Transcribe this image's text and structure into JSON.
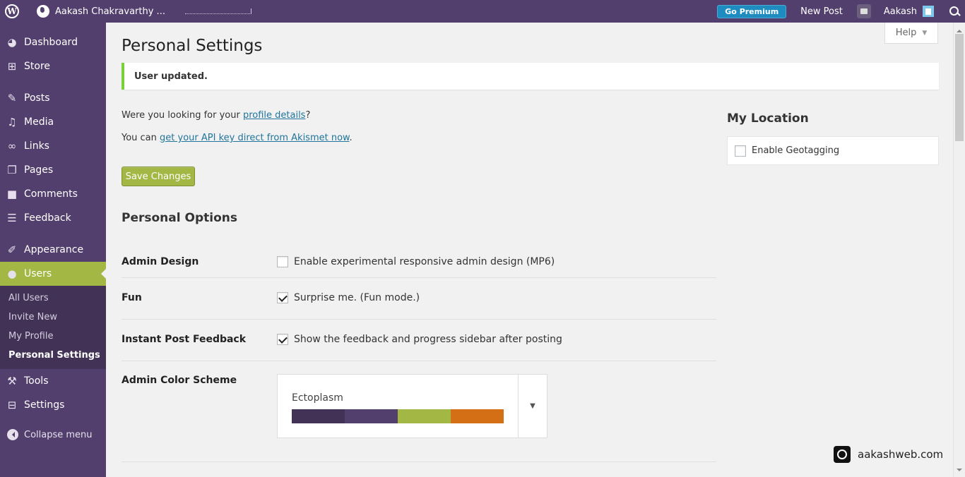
{
  "adminbar": {
    "site_name": "Aakash Chakravarthy ...",
    "go_premium": "Go Premium",
    "new_post": "New Post",
    "user": "Aakash"
  },
  "sidebar": {
    "items": [
      {
        "label": "Dashboard",
        "icon": "dashboard-icon"
      },
      {
        "label": "Store",
        "icon": "cart-icon"
      },
      {
        "label": "Posts",
        "icon": "pin-icon"
      },
      {
        "label": "Media",
        "icon": "media-icon"
      },
      {
        "label": "Links",
        "icon": "link-icon"
      },
      {
        "label": "Pages",
        "icon": "pages-icon"
      },
      {
        "label": "Comments",
        "icon": "comment-icon"
      },
      {
        "label": "Feedback",
        "icon": "feedback-icon"
      },
      {
        "label": "Appearance",
        "icon": "brush-icon"
      },
      {
        "label": "Users",
        "icon": "user-icon"
      },
      {
        "label": "Tools",
        "icon": "wrench-icon"
      },
      {
        "label": "Settings",
        "icon": "settings-icon"
      }
    ],
    "submenu": [
      "All Users",
      "Invite New",
      "My Profile",
      "Personal Settings"
    ],
    "collapse": "Collapse menu"
  },
  "page": {
    "title": "Personal Settings",
    "help": "Help",
    "notice": "User updated.",
    "p1_before": "Were you looking for your ",
    "p1_link": "profile details",
    "p1_after": "?",
    "p2_before": "You can ",
    "p2_link": "get your API key direct from Akismet now",
    "p2_after": ".",
    "save": "Save Changes",
    "section_title": "Personal Options"
  },
  "options": [
    {
      "label": "Admin Design",
      "text": "Enable experimental responsive admin design (MP6)",
      "checked": false
    },
    {
      "label": "Fun",
      "text": "Surprise me. (Fun mode.)",
      "checked": true
    },
    {
      "label": "Instant Post Feedback",
      "text": "Show the feedback and progress sidebar after posting",
      "checked": true
    }
  ],
  "color_scheme": {
    "label": "Admin Color Scheme",
    "selected": "Ectoplasm",
    "swatches": [
      "#413256",
      "#523f6d",
      "#a3b745",
      "#d46f15"
    ]
  },
  "location": {
    "title": "My Location",
    "geotag": "Enable Geotagging"
  },
  "watermark": "aakashweb.com"
}
